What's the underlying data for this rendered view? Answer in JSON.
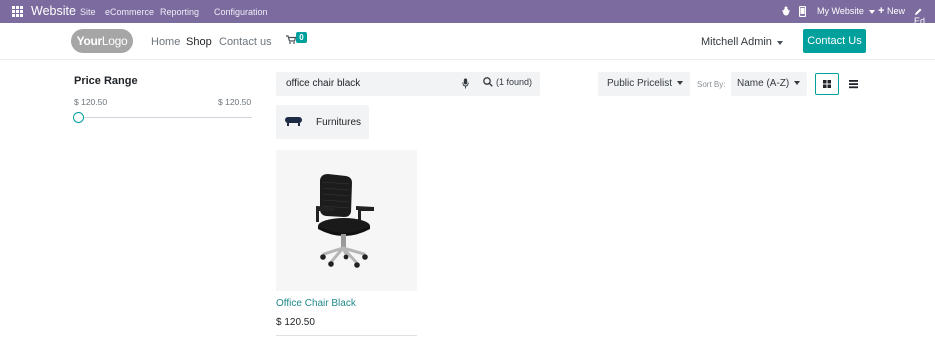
{
  "admin_bar": {
    "brand": "Website",
    "menu": [
      "Site",
      "eCommerce",
      "Reporting",
      "Configuration"
    ],
    "website_switch": "My Website",
    "new_label": "New",
    "edit_label": "Ed"
  },
  "header": {
    "logo": {
      "part1": "Your",
      "part2": "Logo"
    },
    "nav": [
      "Home",
      "Shop",
      "Contact us"
    ],
    "cart_count": "0",
    "user": "Mitchell Admin",
    "contact_button": "Contact Us"
  },
  "price_range": {
    "title": "Price Range",
    "min": "$ 120.50",
    "max": "$ 120.50"
  },
  "search": {
    "value": "office chair black",
    "result_label": "(1 found)"
  },
  "pricelist": "Public Pricelist",
  "sort": {
    "label": "Sort By:",
    "value": "Name (A-Z)"
  },
  "category": {
    "label": "Furnitures"
  },
  "product": {
    "name": "Office Chair Black",
    "price": "$ 120.50"
  },
  "colors": {
    "admin_bar": "#7c6b9e",
    "accent": "#00a09d",
    "product_link": "#218a8b"
  },
  "icons": [
    "apps-icon",
    "bug-icon",
    "mobile-icon",
    "plus-icon",
    "pencil-icon",
    "cart-icon",
    "microphone-icon",
    "search-icon",
    "grid-view-icon",
    "list-view-icon"
  ]
}
